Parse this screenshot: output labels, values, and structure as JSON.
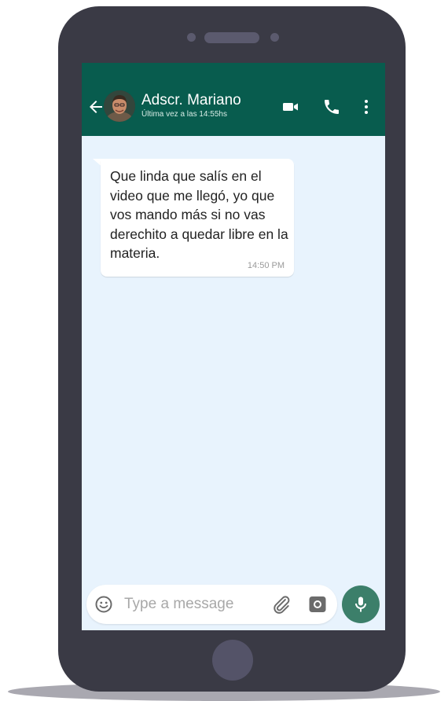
{
  "header": {
    "contact_name": "Adscr. Mariano",
    "last_seen": "Última vez a las 14:55hs"
  },
  "messages": [
    {
      "text": "Que linda que salís en el video que me llegó, yo que vos mando más si no vas derechito a quedar libre en la materia.",
      "time": "14:50 PM",
      "direction": "incoming"
    }
  ],
  "composer": {
    "placeholder": "Type a message"
  },
  "icons": {
    "back": "arrow-left-icon",
    "video": "video-camera-icon",
    "call": "phone-icon",
    "menu": "more-vertical-icon",
    "emoji": "emoji-icon",
    "attach": "paperclip-icon",
    "camera": "camera-icon",
    "mic": "microphone-icon"
  },
  "colors": {
    "header": "#085c4e",
    "chat_background": "#e8f3fd",
    "mic_button": "#3c7f6a",
    "phone_body": "#3a3a45"
  }
}
